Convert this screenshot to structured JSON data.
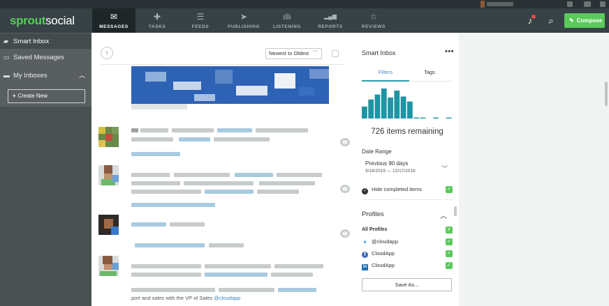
{
  "brand": {
    "logo_left": "sprout",
    "logo_right": "social"
  },
  "nav": {
    "items": [
      {
        "label": "MESSAGES",
        "icon": "envelope-icon",
        "glyph": "✉"
      },
      {
        "label": "TASKS",
        "icon": "pin-icon",
        "glyph": "✚"
      },
      {
        "label": "FEEDS",
        "icon": "list-icon",
        "glyph": "☰"
      },
      {
        "label": "PUBLISHING",
        "icon": "paper-plane-icon",
        "glyph": "➤"
      },
      {
        "label": "LISTENING",
        "icon": "waveform-icon",
        "glyph": "ıllı"
      },
      {
        "label": "REPORTS",
        "icon": "bar-chart-icon",
        "glyph": "▂▄▆"
      },
      {
        "label": "REVIEWS",
        "icon": "star-icon",
        "glyph": "☆"
      }
    ],
    "compose_label": "Compose"
  },
  "sidebar": {
    "items": [
      {
        "label": "Smart Inbox",
        "icon": "inbox-icon"
      },
      {
        "label": "Saved Messages",
        "icon": "bookmark-icon"
      },
      {
        "label": "My Inboxes",
        "icon": "folder-icon"
      }
    ],
    "create_label": "Create New"
  },
  "feed": {
    "sort_value": "Newest to Oldest",
    "caption_text": "port and sales with the VP of Sales",
    "caption_mention": "@cloudapp"
  },
  "panel": {
    "title": "Smart Inbox",
    "more": "•••",
    "tabs": [
      "Filters",
      "Tags"
    ],
    "items_remaining": "726 items remaining",
    "date_range_label": "Date Range",
    "date_range_value": "Previous 90 days",
    "date_range_dates": "9/18/2019 — 12/17/2019",
    "hide_completed": "Hide completed items",
    "profiles_title": "Profiles",
    "profiles": [
      {
        "label": "All Profiles",
        "icon": ""
      },
      {
        "label": "@cloudapp",
        "icon": "twitter-icon"
      },
      {
        "label": "CloudApp",
        "icon": "facebook-icon"
      },
      {
        "label": "CloudApp",
        "icon": "linkedin-icon"
      }
    ],
    "save_as": "Save As..."
  },
  "histogram": {
    "values": [
      12,
      19,
      24,
      30,
      21,
      28,
      22,
      17,
      1,
      1,
      0,
      1,
      0,
      1
    ]
  },
  "colors": {
    "accent": "#59cb59",
    "nav_bg": "#364245",
    "teal": "#1e95a3",
    "link": "#3a86c5"
  }
}
